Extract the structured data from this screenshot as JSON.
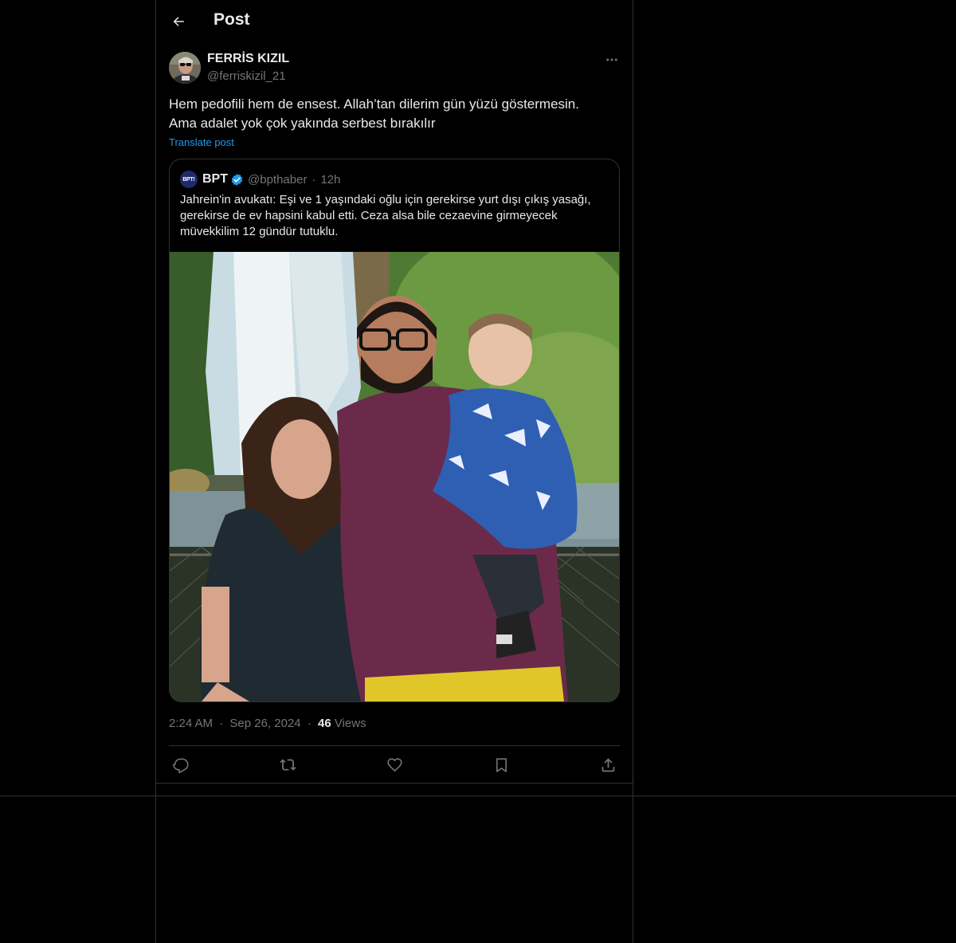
{
  "header": {
    "title": "Post",
    "back_icon": "arrow-left-icon"
  },
  "post": {
    "author": {
      "name": "FERRİS KIZIL",
      "handle": "@ferriskizil_21"
    },
    "text_lines": [
      "Hem pedofili hem de ensest. Allah’tan dilerim gün yüzü göstermesin.",
      "Ama adalet yok çok yakında serbest bırakılır"
    ],
    "translate_label": "Translate post",
    "quoted": {
      "avatar_text": "BPT!",
      "name": "BPT",
      "handle": "@bpthaber",
      "separator": "·",
      "time": "12h",
      "text_lines": [
        "Jahrein'in avukatı: Eşi ve 1 yaşındaki oğlu için gerekirse yurt dışı çıkış yasağı,",
        "gerekirse de ev hapsini kabul etti. Ceza alsa bile cezaevine girmeyecek",
        "müvekkilim 12 gündür tutuklu."
      ]
    },
    "meta": {
      "time": "2:24 AM",
      "separator": "·",
      "date": "Sep 26, 2024",
      "views_count": "46",
      "views_label": "Views"
    }
  },
  "actions": [
    {
      "name": "reply",
      "icon": "reply-icon"
    },
    {
      "name": "repost",
      "icon": "repost-icon"
    },
    {
      "name": "like",
      "icon": "heart-icon"
    },
    {
      "name": "bookmark",
      "icon": "bookmark-icon"
    },
    {
      "name": "share",
      "icon": "share-icon"
    }
  ],
  "colors": {
    "background": "#000000",
    "text_primary": "#e7e9ea",
    "text_secondary": "#71767b",
    "link": "#1d9bf0",
    "border": "#2f3336",
    "verified": "#1d9bf0"
  }
}
